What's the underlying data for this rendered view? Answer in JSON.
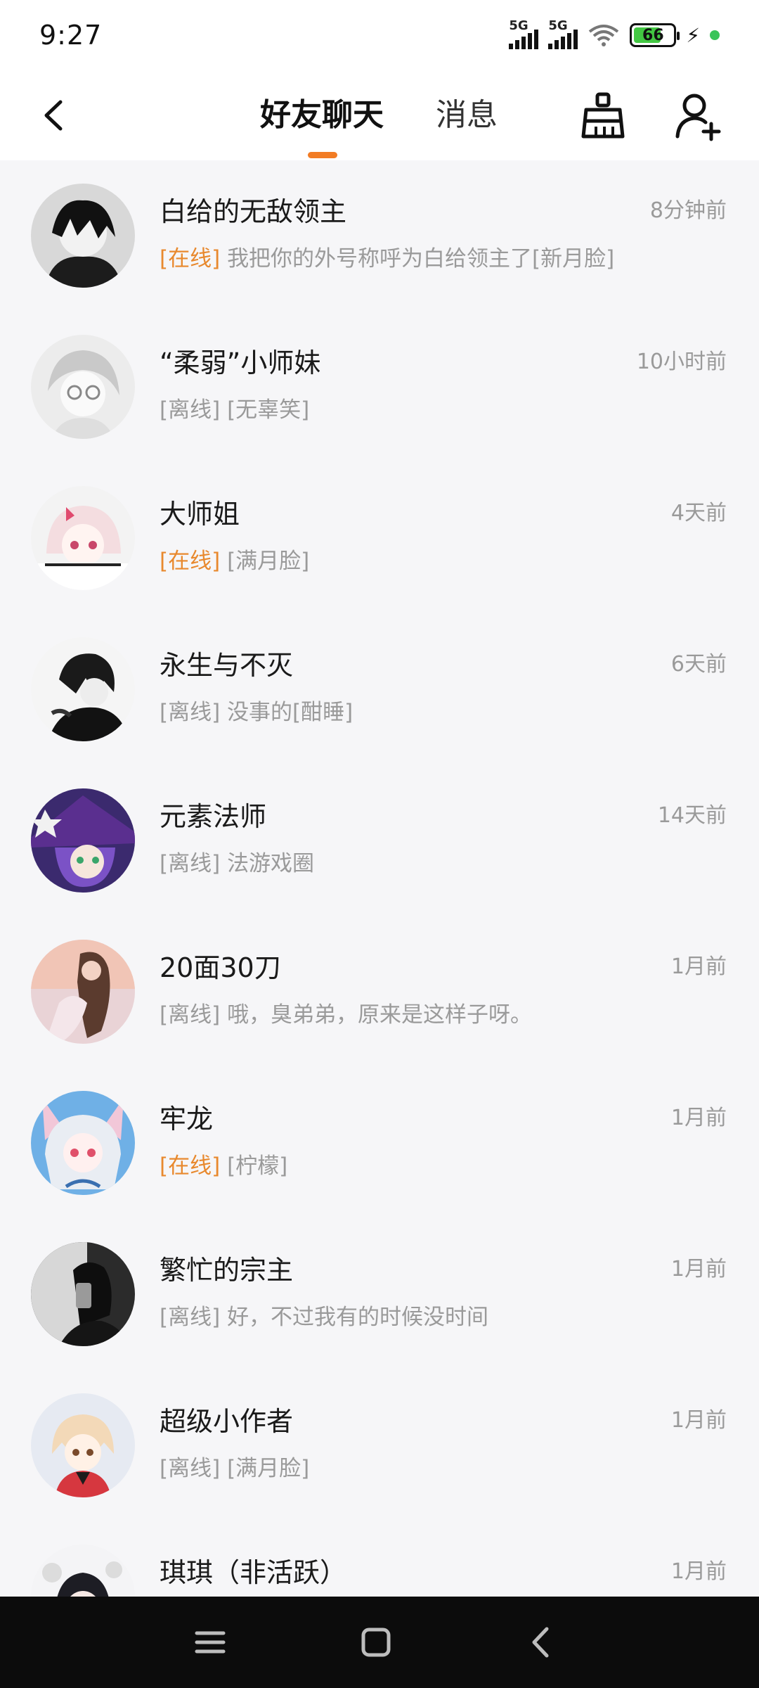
{
  "status_bar": {
    "time": "9:27",
    "network_1": "5G",
    "network_2": "5G",
    "battery": "66"
  },
  "header": {
    "tab_friends_chat": "好友聊天",
    "tab_messages": "消息",
    "accent_color": "#f27c24"
  },
  "chats": [
    {
      "name": "白给的无敌领主",
      "time": "8分钟前",
      "status": "[在线]",
      "online": true,
      "preview": "我把你的外号称呼为白给领主了[新月脸]"
    },
    {
      "name": "“柔弱”小师妹",
      "time": "10小时前",
      "status": "[离线]",
      "online": false,
      "preview": "[无辜笑]"
    },
    {
      "name": "大师姐",
      "time": "4天前",
      "status": "[在线]",
      "online": true,
      "preview": "[满月脸]"
    },
    {
      "name": "永生与不灭",
      "time": "6天前",
      "status": "[离线]",
      "online": false,
      "preview": "没事的[酣睡]"
    },
    {
      "name": "元素法师",
      "time": "14天前",
      "status": "[离线]",
      "online": false,
      "preview": "法游戏圈"
    },
    {
      "name": "20面30刀",
      "time": "1月前",
      "status": "[离线]",
      "online": false,
      "preview": "哦，臭弟弟，原来是这样子呀。"
    },
    {
      "name": "牢龙",
      "time": "1月前",
      "status": "[在线]",
      "online": true,
      "preview": "[柠檬]"
    },
    {
      "name": "繁忙的宗主",
      "time": "1月前",
      "status": "[离线]",
      "online": false,
      "preview": "好，不过我有的时候没时间"
    },
    {
      "name": "超级小作者",
      "time": "1月前",
      "status": "[离线]",
      "online": false,
      "preview": "[满月脸]"
    },
    {
      "name": "琪琪（非活跃）",
      "time": "1月前",
      "status": "",
      "online": false,
      "preview": ""
    }
  ]
}
